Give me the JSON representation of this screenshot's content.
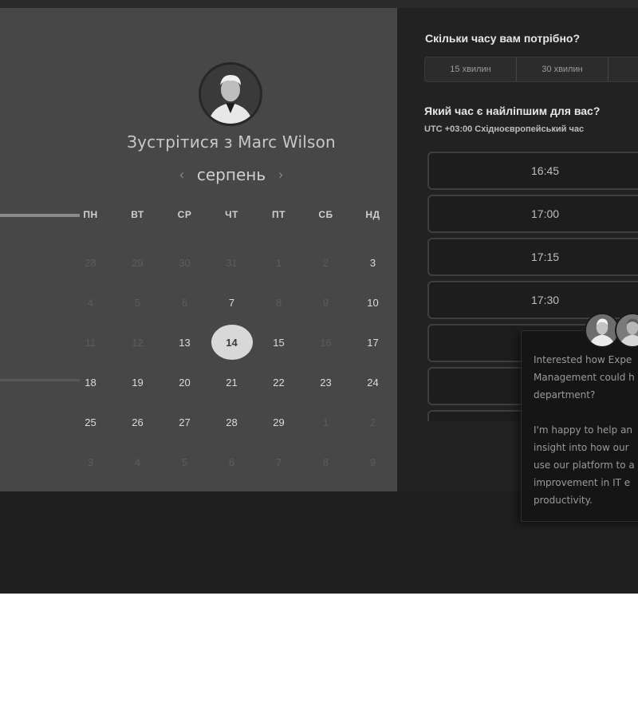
{
  "meeting": {
    "title": "Зустрітися з Marc Wilson"
  },
  "calendar": {
    "month": "серпень",
    "prev_icon": "chevron-left-icon",
    "next_icon": "chevron-right-icon",
    "weekdays": [
      "ПН",
      "ВТ",
      "СР",
      "ЧТ",
      "ПТ",
      "СБ",
      "НД"
    ],
    "days": [
      {
        "d": "28",
        "s": "muted"
      },
      {
        "d": "29",
        "s": "muted"
      },
      {
        "d": "30",
        "s": "muted"
      },
      {
        "d": "31",
        "s": "muted"
      },
      {
        "d": "1",
        "s": "muted"
      },
      {
        "d": "2",
        "s": "muted"
      },
      {
        "d": "3",
        "s": "avail"
      },
      {
        "d": "4",
        "s": "muted"
      },
      {
        "d": "5",
        "s": "muted"
      },
      {
        "d": "6",
        "s": "muted"
      },
      {
        "d": "7",
        "s": "avail"
      },
      {
        "d": "8",
        "s": "muted"
      },
      {
        "d": "9",
        "s": "muted"
      },
      {
        "d": "10",
        "s": "avail"
      },
      {
        "d": "11",
        "s": "muted"
      },
      {
        "d": "12",
        "s": "muted"
      },
      {
        "d": "13",
        "s": "avail"
      },
      {
        "d": "14",
        "s": "selected"
      },
      {
        "d": "15",
        "s": "avail"
      },
      {
        "d": "16",
        "s": "muted"
      },
      {
        "d": "17",
        "s": "avail"
      },
      {
        "d": "18",
        "s": "avail"
      },
      {
        "d": "19",
        "s": "avail"
      },
      {
        "d": "20",
        "s": "avail"
      },
      {
        "d": "21",
        "s": "avail"
      },
      {
        "d": "22",
        "s": "avail"
      },
      {
        "d": "23",
        "s": "avail"
      },
      {
        "d": "24",
        "s": "avail"
      },
      {
        "d": "25",
        "s": "avail"
      },
      {
        "d": "26",
        "s": "avail"
      },
      {
        "d": "27",
        "s": "avail"
      },
      {
        "d": "28",
        "s": "avail"
      },
      {
        "d": "29",
        "s": "avail"
      },
      {
        "d": "1",
        "s": "muted"
      },
      {
        "d": "2",
        "s": "muted"
      },
      {
        "d": "3",
        "s": "muted"
      },
      {
        "d": "4",
        "s": "muted"
      },
      {
        "d": "5",
        "s": "muted"
      },
      {
        "d": "6",
        "s": "muted"
      },
      {
        "d": "7",
        "s": "muted"
      },
      {
        "d": "8",
        "s": "muted"
      },
      {
        "d": "9",
        "s": "muted"
      }
    ]
  },
  "duration": {
    "question": "Скільки часу вам потрібно?",
    "options": [
      "15 хвилин",
      "30 хвилин",
      ""
    ]
  },
  "times": {
    "question": "Який час є найліпшим для вас?",
    "timezone": "UTC +03:00 Східноєвропейський час",
    "slots": [
      "16:45",
      "17:00",
      "17:15",
      "17:30",
      "",
      "",
      ""
    ]
  },
  "chat": {
    "message": "Interested how Expe\nManagement could h\ndepartment?\n\nI'm happy to help an\ninsight into how our\nuse our platform to a\nimprovement in IT e\nproductivity."
  }
}
